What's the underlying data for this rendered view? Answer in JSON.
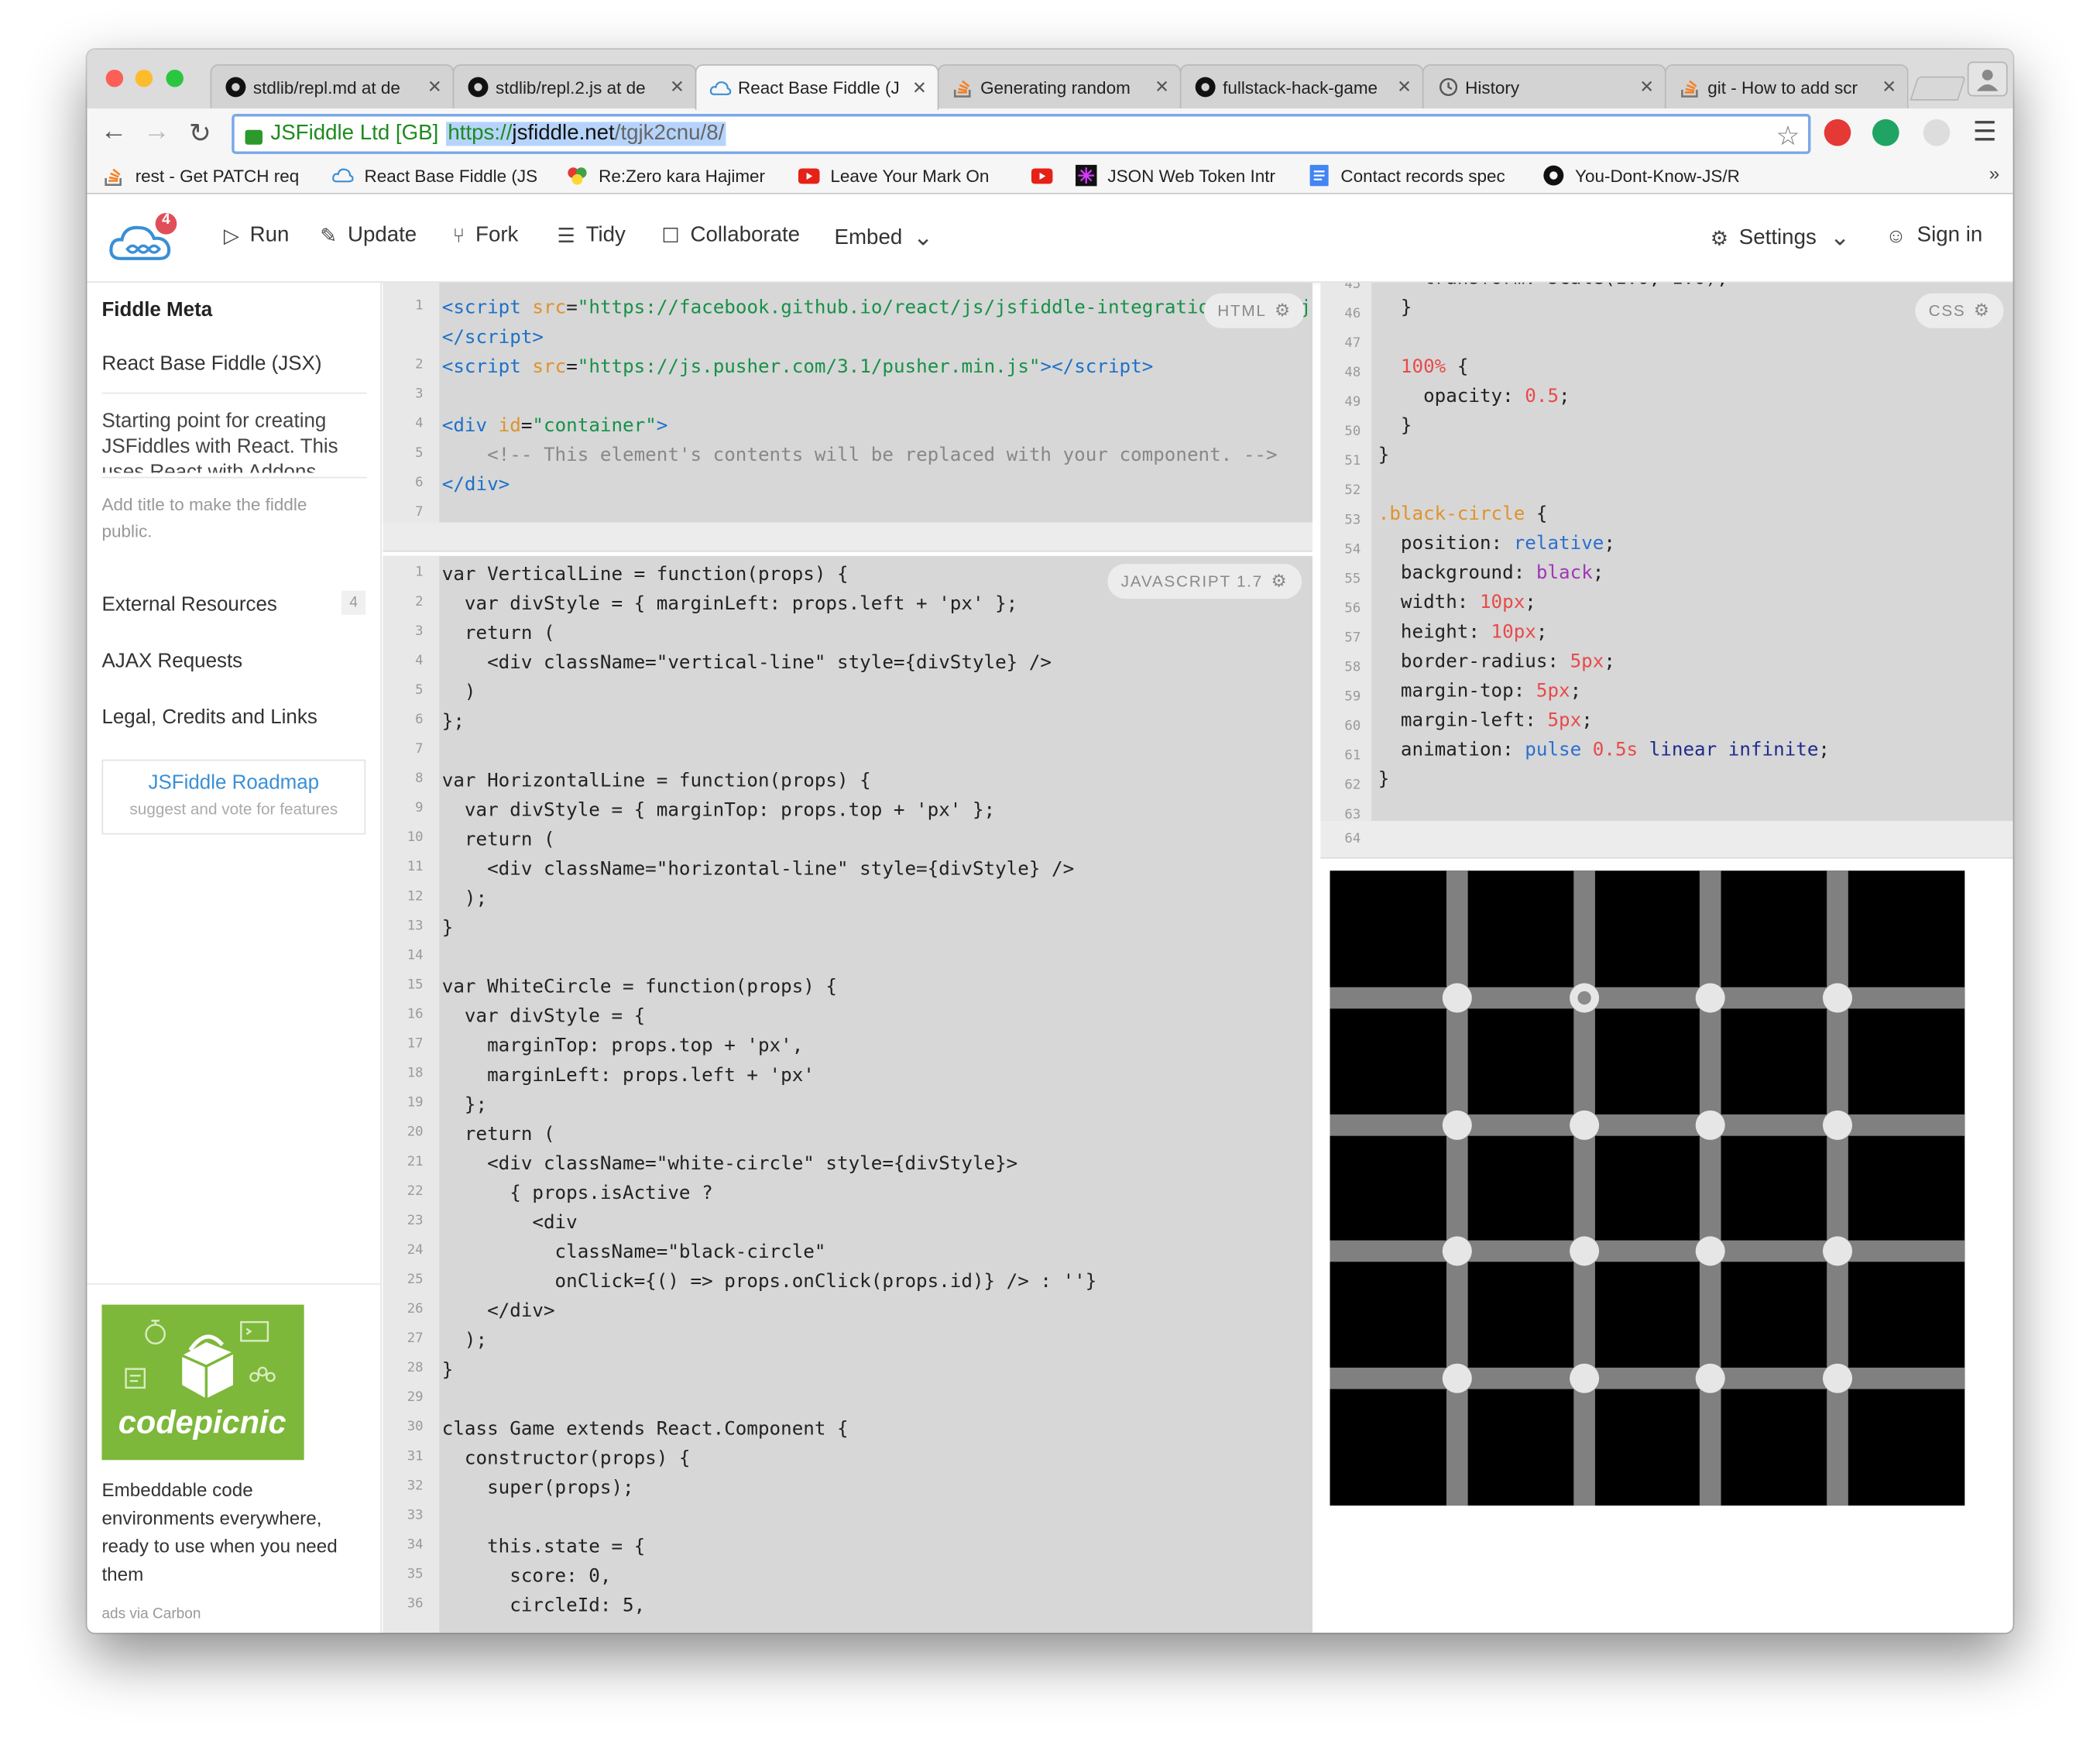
{
  "browser": {
    "tabs": [
      {
        "title": "stdlib/repl.md at de",
        "icon": "github-icon"
      },
      {
        "title": "stdlib/repl.2.js at de",
        "icon": "github-icon"
      },
      {
        "title": "React Base Fiddle (J",
        "icon": "jsfiddle-icon",
        "active": true
      },
      {
        "title": "Generating random",
        "icon": "stackoverflow-icon"
      },
      {
        "title": "fullstack-hack-game",
        "icon": "github-icon"
      },
      {
        "title": "History",
        "icon": "history-icon"
      },
      {
        "title": "git - How to add scr",
        "icon": "stackoverflow-icon"
      }
    ],
    "close_glyph": "✕",
    "nav": {
      "back": "←",
      "forward": "→",
      "reload": "↻",
      "star": "☆",
      "menu": "☰"
    },
    "address": {
      "ev_label": "JSFiddle Ltd [GB]",
      "scheme": "https://",
      "host": "jsfiddle.net",
      "path": "/tgjk2cnu/8/"
    },
    "bookmarks": [
      {
        "label": "rest - Get PATCH req",
        "icon": "stackoverflow-icon"
      },
      {
        "label": "React Base Fiddle (JS",
        "icon": "jsfiddle-icon"
      },
      {
        "label": "Re:Zero kara Hajimer",
        "icon": "rezero-icon"
      },
      {
        "label": "Leave Your Mark On",
        "icon": "youtube-icon"
      },
      {
        "label": "",
        "icon": "youtube-icon"
      },
      {
        "label": "JSON Web Token Intr",
        "icon": "jwt-icon"
      },
      {
        "label": "Contact records spec",
        "icon": "docs-icon"
      },
      {
        "label": "You-Dont-Know-JS/R",
        "icon": "github-icon"
      }
    ],
    "bookmarks_more": "»"
  },
  "header": {
    "logo_badge": "4",
    "actions": [
      {
        "label": "Run",
        "icon": "▷"
      },
      {
        "label": "Update",
        "icon": "✎"
      },
      {
        "label": "Fork",
        "icon": "⑂"
      },
      {
        "label": "Tidy",
        "icon": "☰"
      },
      {
        "label": "Collaborate",
        "icon": "☐"
      },
      {
        "label": "Embed",
        "icon": "⌄"
      }
    ],
    "settings_label": "Settings",
    "signin_label": "Sign in"
  },
  "sidebar": {
    "title": "Fiddle Meta",
    "fiddle_name": "React Base Fiddle (JSX)",
    "description": "Starting point for creating JSFiddles with React. This uses React with Addons.",
    "hint": "Add title to make the fiddle public.",
    "external_resources": "External Resources",
    "external_count": "4",
    "ajax": "AJAX Requests",
    "legal": "Legal, Credits and Links",
    "roadmap_title": "JSFiddle Roadmap",
    "roadmap_sub": "suggest and vote for features",
    "ad_brand": "codepicnic",
    "ad_text": "Embeddable code environments everywhere, ready to use when you need them",
    "ad_footer": "ads via Carbon"
  },
  "editors": {
    "html": {
      "badge": "HTML",
      "line_numbers": [
        "1",
        "",
        "2",
        "3",
        "4",
        "5",
        "6",
        "7"
      ]
    },
    "javascript": {
      "badge": "JAVASCRIPT 1.7",
      "line_numbers": [
        "1",
        "2",
        "3",
        "4",
        "5",
        "6",
        "7",
        "8",
        "9",
        "10",
        "11",
        "12",
        "13",
        "14",
        "15",
        "16",
        "17",
        "18",
        "19",
        "20",
        "21",
        "22",
        "23",
        "24",
        "25",
        "26",
        "27",
        "28",
        "29",
        "30",
        "31",
        "32",
        "33",
        "34",
        "35",
        "36"
      ],
      "lines": [
        "var VerticalLine = function(props) {",
        "  var divStyle = { marginLeft: props.left + 'px' };",
        "  return (",
        "    <div className=\"vertical-line\" style={divStyle} />",
        "  )",
        "};",
        "",
        "var HorizontalLine = function(props) {",
        "  var divStyle = { marginTop: props.top + 'px' };",
        "  return (",
        "    <div className=\"horizontal-line\" style={divStyle} />",
        "  );",
        "}",
        "",
        "var WhiteCircle = function(props) {",
        "  var divStyle = {",
        "    marginTop: props.top + 'px',",
        "    marginLeft: props.left + 'px'",
        "  };",
        "  return (",
        "    <div className=\"white-circle\" style={divStyle}>",
        "      { props.isActive ?",
        "        <div",
        "          className=\"black-circle\"",
        "          onClick={() => props.onClick(props.id)} /> : ''}",
        "    </div>",
        "  );",
        "}",
        "",
        "class Game extends React.Component {",
        "  constructor(props) {",
        "    super(props);",
        "",
        "    this.state = {",
        "      score: 0,",
        "      circleId: 5,"
      ]
    },
    "css": {
      "badge": "CSS",
      "line_numbers": [
        "45",
        "46",
        "47",
        "48",
        "49",
        "50",
        "51",
        "52",
        "53",
        "54",
        "55",
        "56",
        "57",
        "58",
        "59",
        "60",
        "61",
        "62",
        "63",
        "64"
      ]
    }
  },
  "result": {
    "grid_rows": 4,
    "grid_cols": 4,
    "active_circle": {
      "row": 0,
      "col": 1
    },
    "colors": {
      "background": "#000000",
      "line": "#808080",
      "circle": "#e6e6e6",
      "dot": "#8a8a8a"
    }
  },
  "colors": {
    "accent": "#3a8fd6",
    "editor_bg": "#d7d7d7",
    "ad_green": "#7db83a",
    "ev_green": "#1e8b1e"
  }
}
